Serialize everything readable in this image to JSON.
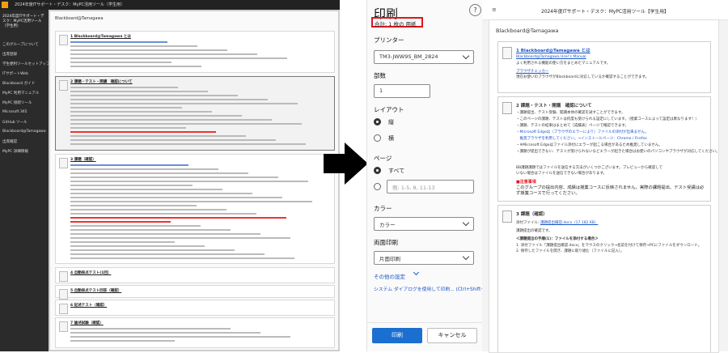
{
  "left_screenshot": {
    "window_title": "2024年度ITサポート・デスク：MyPC活用ツール（学生用）",
    "sidebar_header": "2024年度ITサポート・デスク：MyPC活用ツール（学生用）",
    "sidebar_items": [
      "このグループについて",
      "出席登録",
      "学生便利ツールセットアップ",
      "ITサポートWeb",
      "Blackboard ガイド",
      "MyPC 利用マニュアル",
      "MyPC 接続ツール",
      "Microsoft 365",
      "GitHub ツール",
      "Blackboard@Tamagawa",
      "出席確認",
      "MyPC 詳細情報"
    ],
    "breadcrumb": "Blackboard@Tamagawa",
    "cards": [
      {
        "title": "1 Blackboard@Tamagawa とは"
      },
      {
        "title": "2 課題・テスト・開講　確認について"
      },
      {
        "title": "3 課題（確認）"
      },
      {
        "title": "4 自動採点テスト(1回）"
      },
      {
        "title": "5 自動採点テスト回答（確認）"
      },
      {
        "title": "6 記述テスト（確認）"
      },
      {
        "title": "7 論述試験（確認）"
      }
    ]
  },
  "print_dialog": {
    "title": "印刷",
    "total": "合計: 1 枚の 用紙",
    "help_label": "?",
    "printer_label": "プリンター",
    "printer_value": "TM3-JWW9S_BM_2824",
    "copies_label": "部数",
    "copies_value": "1",
    "layout_label": "レイアウト",
    "layout_options": [
      "縦",
      "横"
    ],
    "pages_label": "ページ",
    "pages_all": "すべて",
    "pages_placeholder": "例: 1-5, 8, 11-13",
    "color_label": "カラー",
    "color_value": "カラー",
    "duplex_label": "両面印刷",
    "duplex_value": "片面印刷",
    "more_settings": "その他の設定",
    "system_dialog": "システム ダイアログを使用して印刷... (Ctrl+Shift+P)",
    "print_button": "印刷",
    "cancel_button": "キャンセル"
  },
  "preview": {
    "header_title": "2024年度ITサポート・デスク：MyPC活用ツール【学生用】",
    "breadcrumb": "Blackboard@Tamagawa",
    "section1": {
      "title": "1 Blackboard@Tamagawa とは",
      "link": "Blackboard@Tamagawa User's Manual",
      "text1": "よく利用される機能の使い方をまとめたマニュアルです。",
      "link2": "ブラウザチェッカー",
      "text2": "現在お使いのブラウザがBlackboardに対応しているか確認することができます。"
    },
    "section2": {
      "title": "2 課題・テスト・開講　確認について",
      "lines": [
        "・課題提出、テスト受験、開講本体の確認を試すことができます。",
        "・このページの課題、テストは何度も受けられる設定にしています。（授業コースによって設定は異なります！）",
        "・課題、テストの結果はまとめて［成績表］ページで確認できます。",
        "・Microsoft Edgeは（ブラウザのエラーにより）ファイルの添付が出来ません。",
        "　推奨ブラウザを利用してください。→インストールページ：Chrome / Firefox",
        "・※Microsoft Edgeはファイル添付にエラーが起こる場合があるため推奨していません。",
        "・課題が提出できない、テストが受けられないなどエラーが起きた場合はお使いのパソコンやブラウザが対応してください。"
      ],
      "text_a": "BB課題課題ではファイルを送信する方法がいくつかございます。プレビューから確認して",
      "text_b": "いない場合はファイルを送信できない場合があります。",
      "notice_title": "■注意事項",
      "notice_text": "このグループの提出内容、成績は授業コースに反映されません。実際の課題提出、テスト受講は必ず授業コースで行ってください。"
    },
    "section3": {
      "title": "3 課題（確認）",
      "attachment": "添付ファイル：",
      "file": "課題提出確認.docx（17.182 KB）",
      "text1": "課題提出の確認です。",
      "sub": "＜課題提出の手順(1)：ファイルを添付する場合＞",
      "step1": "1. 添付ファイル「課題提出確認.docx」をマウスのクリック→名前を付けて保存→PCにファイルをダウンロード。",
      "step2": "2. 保存したファイルを開き、課題に取り組む（ファイルに記入）。"
    }
  },
  "colors": {
    "highlight_border": "#e0141e",
    "print_button": "#1a6fd0",
    "link": "#1a55c8",
    "notice_red": "#e0141e"
  }
}
